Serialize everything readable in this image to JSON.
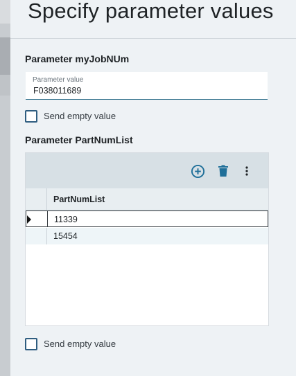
{
  "dialog": {
    "title": "Specify parameter values"
  },
  "param1": {
    "label": "Parameter myJobNUm",
    "field_floating_label": "Parameter value",
    "value": "F038011689",
    "send_empty_label": "Send empty value"
  },
  "param2": {
    "label": "Parameter PartNumList",
    "grid": {
      "toolbar": {
        "add_icon": "add-circle-icon",
        "delete_icon": "trash-icon",
        "more_icon": "more-vertical-icon"
      },
      "column_header": "PartNumList",
      "rows": [
        "11339",
        "15454"
      ]
    },
    "send_empty_label": "Send empty value"
  },
  "colors": {
    "accent": "#1f6f99",
    "panel_bg": "#eef2f5",
    "toolbar_bg": "#d7e0e5"
  }
}
